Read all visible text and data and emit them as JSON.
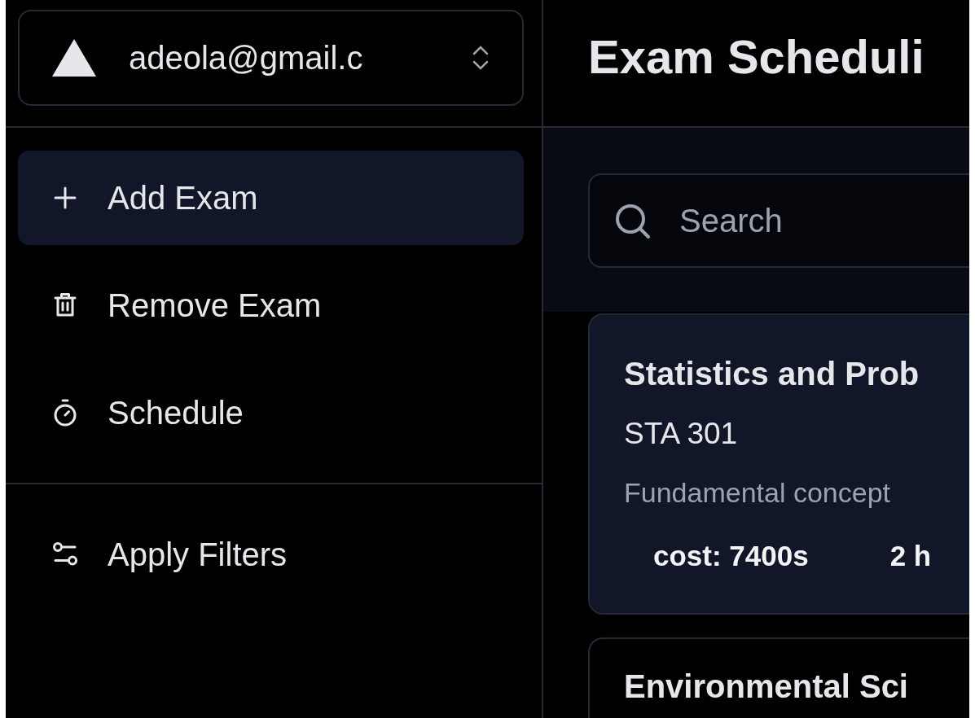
{
  "sidebar": {
    "account": {
      "label": "adeola@gmail.c"
    },
    "groups": [
      [
        {
          "kind": "add",
          "label": "Add Exam",
          "selected": true
        },
        {
          "kind": "remove",
          "label": "Remove Exam",
          "selected": false
        },
        {
          "kind": "schedule",
          "label": "Schedule",
          "selected": false
        }
      ],
      [
        {
          "kind": "filter",
          "label": "Apply Filters",
          "selected": false
        }
      ]
    ]
  },
  "header": {
    "title": "Exam Scheduli"
  },
  "search": {
    "placeholder": "Search"
  },
  "cards": [
    {
      "title": "Statistics and Prob",
      "code": "STA 301",
      "description": "Fundamental concept",
      "stats": [
        "cost: 7400s",
        "2 h"
      ]
    },
    {
      "title": "Environmental Sci"
    }
  ]
}
